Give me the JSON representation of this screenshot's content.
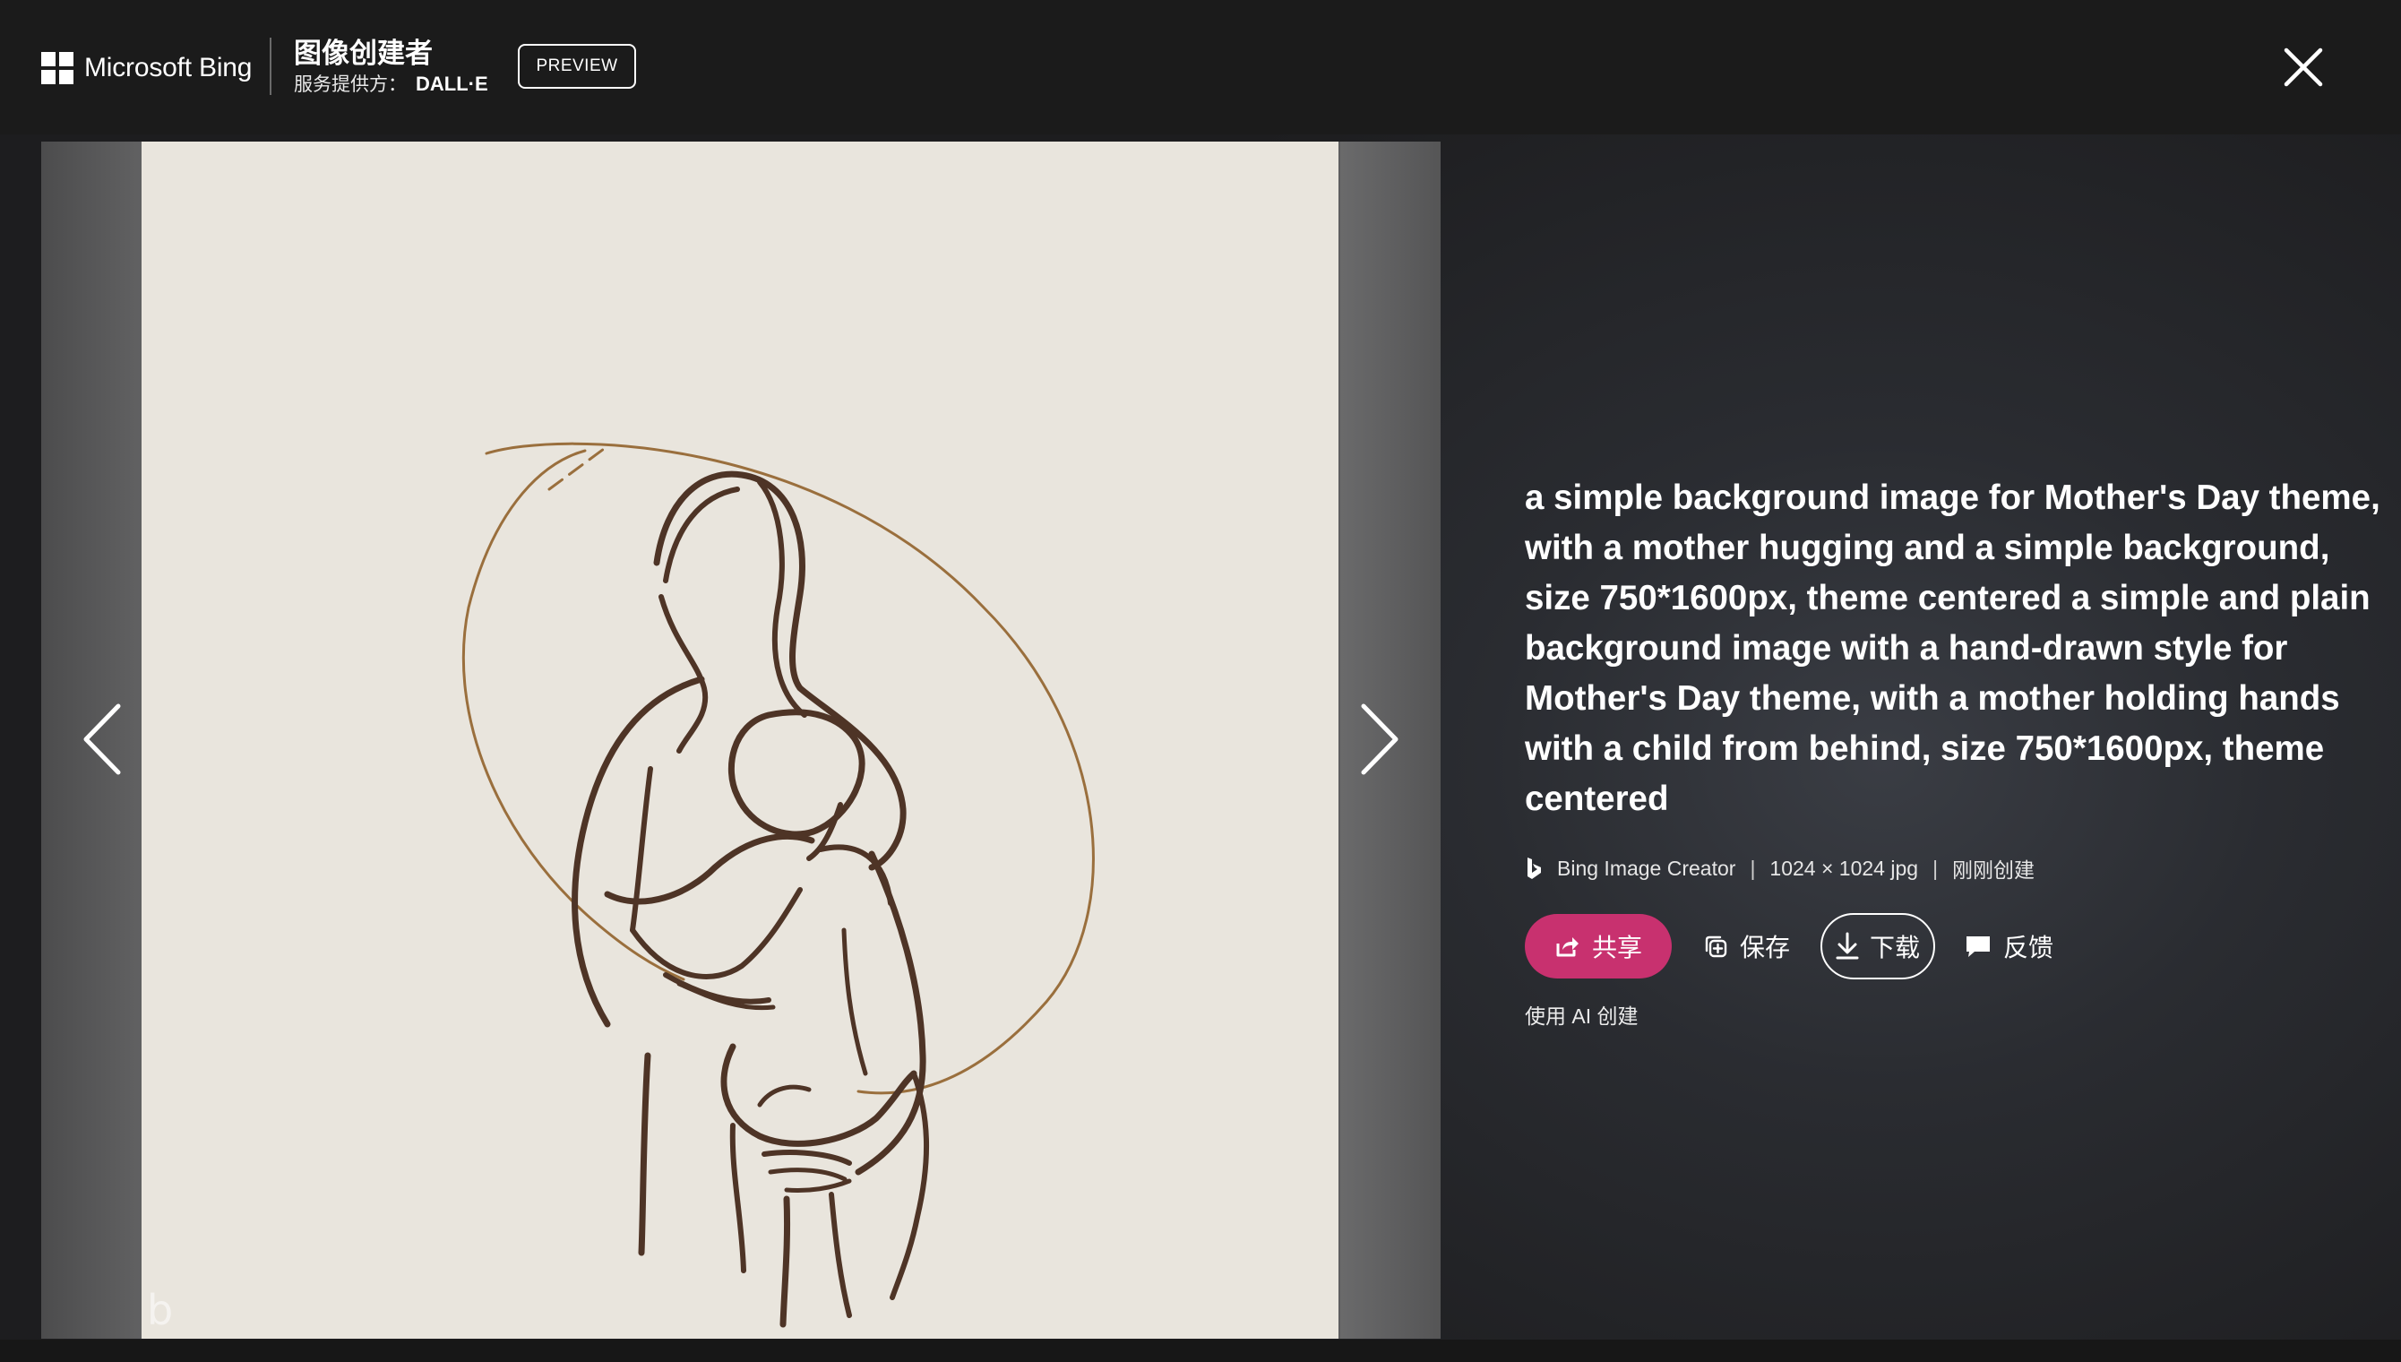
{
  "header": {
    "brand_name": "Microsoft Bing",
    "product_title": "图像创建者",
    "product_sub_prefix": "服务提供方：",
    "product_sub_provider": "DALL·E",
    "preview_badge": "PREVIEW"
  },
  "image": {
    "description": "Hand-drawn line art of a mother hugging a child",
    "prompt": "a simple background image for Mother's Day theme, with a mother hugging and a simple background, size 750*1600px, theme centered a simple and plain background image with a hand-drawn style for Mother's Day theme, with a mother holding hands with a child from behind, size 750*1600px, theme centered",
    "source": "Bing Image Creator",
    "dimensions": "1024 × 1024 jpg",
    "created": "刚刚创建",
    "separator": "|"
  },
  "actions": {
    "share": "共享",
    "save": "保存",
    "download": "下载",
    "feedback": "反馈"
  },
  "ai_note": "使用 AI 创建",
  "colors": {
    "share_button": "#c8316f",
    "header_bg": "#1b1b1b",
    "canvas_bg": "#e9e5dd"
  },
  "icons": {
    "logo": "microsoft-logo-icon",
    "close": "close-icon",
    "prev": "chevron-left-icon",
    "next": "chevron-right-icon",
    "bing": "bing-icon",
    "share": "share-icon",
    "save": "collection-add-icon",
    "download": "download-icon",
    "feedback": "feedback-icon"
  }
}
